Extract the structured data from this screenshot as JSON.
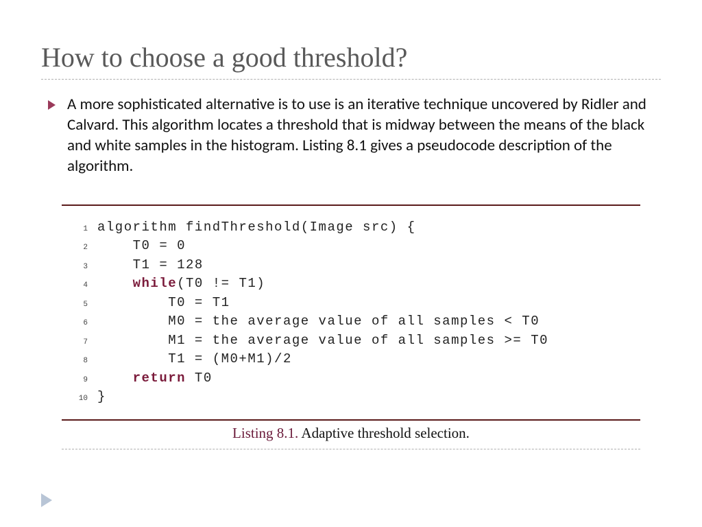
{
  "title": "How to choose a good threshold?",
  "paragraph": "A more sophisticated alternative is to use is an iterative technique uncovered by Ridler and Calvard.  This algorithm locates a threshold that is midway between the means of the black and white samples in the histogram.  Listing 8.1 gives a pseudocode description of the algorithm.",
  "listing": {
    "label": "Listing 8.1.",
    "caption": "Adaptive threshold selection.",
    "lines": [
      {
        "n": "1",
        "pre": "",
        "kw": "",
        "txt": "algorithm findThreshold(Image src) {"
      },
      {
        "n": "2",
        "pre": "    ",
        "kw": "",
        "txt": "T0 = 0"
      },
      {
        "n": "3",
        "pre": "    ",
        "kw": "",
        "txt": "T1 = 128"
      },
      {
        "n": "4",
        "pre": "    ",
        "kw": "while",
        "txt": "(T0 != T1)"
      },
      {
        "n": "5",
        "pre": "        ",
        "kw": "",
        "txt": "T0 = T1"
      },
      {
        "n": "6",
        "pre": "        ",
        "kw": "",
        "txt": "M0 = the average value of all samples < T0"
      },
      {
        "n": "7",
        "pre": "        ",
        "kw": "",
        "txt": "M1 = the average value of all samples >= T0"
      },
      {
        "n": "8",
        "pre": "        ",
        "kw": "",
        "txt": "T1 = (M0+M1)/2"
      },
      {
        "n": "9",
        "pre": "    ",
        "kw": "return",
        "txt": " T0"
      },
      {
        "n": "10",
        "pre": "",
        "kw": "",
        "txt": "}"
      }
    ]
  },
  "colors": {
    "title": "#595959",
    "keyword": "#7a1a3a",
    "rule": "#5a1a1a",
    "bullet": "#9a3a5a"
  }
}
